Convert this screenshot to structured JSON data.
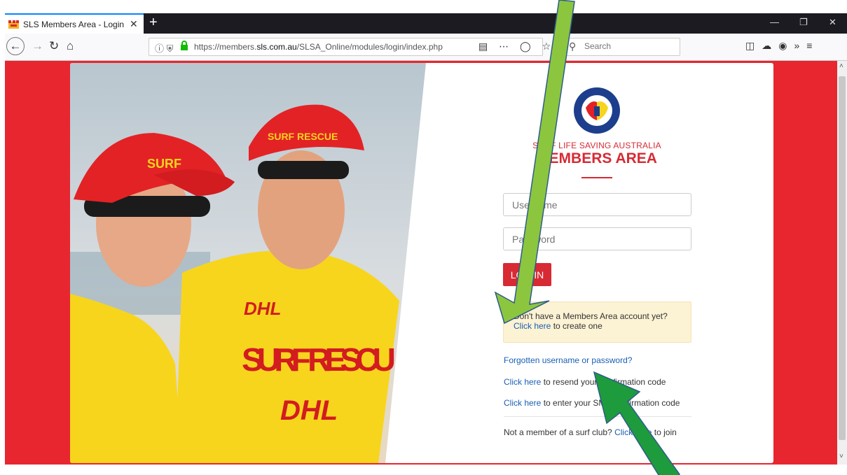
{
  "browser": {
    "tab_title": "SLS Members Area - Login",
    "tab_close": "✕",
    "new_tab": "+",
    "url_domain_prefix": "https://members.",
    "url_domain_bold": "sls.com.au",
    "url_path": "/SLSA_Online/modules/login/index.php",
    "search_placeholder": "Search",
    "icons": {
      "back": "back-arrow-icon",
      "forward": "forward-arrow-icon",
      "reload": "reload-icon",
      "home": "home-icon"
    }
  },
  "login": {
    "org_name": "SURF LIFE SAVING AUSTRALIA",
    "title": "MEMBERS AREA",
    "username_placeholder": "Username",
    "password_placeholder": "Password",
    "login_button": "LOG IN",
    "account_prompt": "Don't have a Members Area account yet?",
    "account_link": "Click here",
    "account_suffix": " to create one",
    "forgot_link": "Forgotten username or password?",
    "resend_link": "Click here",
    "resend_suffix": " to resend your confirmation code",
    "sms_link": "Click here",
    "sms_suffix": " to enter your SMS confirmation code",
    "join_prefix": "Not a member of a surf club? ",
    "join_link": "Click here",
    "join_suffix": " to join"
  },
  "photo": {
    "cap_text_left": "SURF",
    "cap_text_right": "SURF RESCUE",
    "shirt_brand": "DHL",
    "shirt_text": "SURF RESCU"
  },
  "colors": {
    "brand_red": "#d72a34",
    "page_red": "#e7262f",
    "annotation_arrow": "#6cc24a"
  }
}
